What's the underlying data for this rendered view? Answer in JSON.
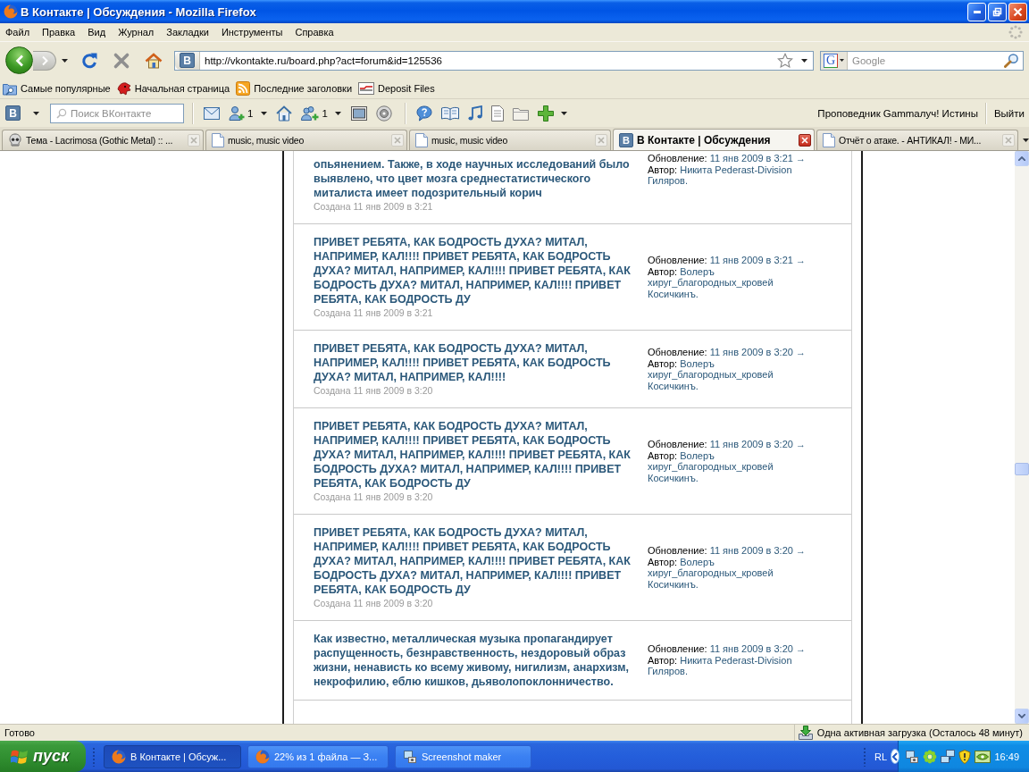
{
  "window": {
    "title": "В Контакте | Обсуждения - Mozilla Firefox"
  },
  "menu": [
    "Файл",
    "Правка",
    "Вид",
    "Журнал",
    "Закладки",
    "Инструменты",
    "Справка"
  ],
  "navigation": {
    "site_icon": "В",
    "url": "http://vkontakte.ru/board.php?act=forum&id=125536",
    "search_engine_icon": "G",
    "search": {
      "placeholder": "Google"
    }
  },
  "bookmarks": [
    {
      "kind": "folder",
      "label": "Самые популярные"
    },
    {
      "kind": "beast",
      "label": "Начальная страница"
    },
    {
      "kind": "feed",
      "label": "Последние заголовки"
    },
    {
      "kind": "card",
      "label": "Deposit Files"
    }
  ],
  "vk_toolbar": {
    "logo": "В",
    "search": {
      "placeholder": "Поиск ВКонтакте"
    },
    "counters": [
      "1",
      "1"
    ],
    "user_link": "Проповедник Gammaлуч! Истины",
    "logout": "Выйти"
  },
  "tabs": [
    {
      "kind": "skull",
      "label": "Тема - Lacrimosa (Gothic Metal) :: ...",
      "selected": false
    },
    {
      "kind": "page",
      "label": "music, music video",
      "selected": false
    },
    {
      "kind": "page",
      "label": "music, music video",
      "selected": false
    },
    {
      "kind": "logo",
      "icon_letter": "В",
      "label": "В Контакте | Обсуждения",
      "selected": true
    },
    {
      "kind": "page",
      "label": "Отчёт о атаке. - АНТИКАЛ! - МИ...",
      "selected": false
    }
  ],
  "topics": [
    {
      "title": "опьянением. Также, в ходе научных исследований было выявлено, что цвет мозга среднестатистического миталиста имеет подозрительный корич",
      "created": "Создана 11 янв 2009 в 3:21",
      "updated_label": "Обновление:",
      "updated": "11 янв 2009 в 3:21 →",
      "author_label": "Автор:",
      "author": "Никита Pederast-Division Гиляров."
    },
    {
      "title": "ПРИВЕТ РЕБЯТА, КАК БОДРОСТЬ ДУХА? МИТАЛ, НАПРИМЕР, КАЛ!!!! ПРИВЕТ РЕБЯТА, КАК БОДРОСТЬ ДУХА? МИТАЛ, НАПРИМЕР, КАЛ!!!! ПРИВЕТ РЕБЯТА, КАК БОДРОСТЬ ДУХА? МИТАЛ, НАПРИМЕР, КАЛ!!!! ПРИВЕТ РЕБЯТА, КАК БОДРОСТЬ ДУ",
      "created": "Создана 11 янв 2009 в 3:21",
      "updated_label": "Обновление:",
      "updated": "11 янв 2009 в 3:21 →",
      "author_label": "Автор:",
      "author": "Волеръ хируг_благородных_кровей Косичкинъ."
    },
    {
      "title": "ПРИВЕТ РЕБЯТА, КАК БОДРОСТЬ ДУХА? МИТАЛ, НАПРИМЕР, КАЛ!!!! ПРИВЕТ РЕБЯТА, КАК БОДРОСТЬ ДУХА? МИТАЛ, НАПРИМЕР, КАЛ!!!!",
      "created": "Создана 11 янв 2009 в 3:20",
      "updated_label": "Обновление:",
      "updated": "11 янв 2009 в 3:20 →",
      "author_label": "Автор:",
      "author": "Волеръ хируг_благородных_кровей Косичкинъ."
    },
    {
      "title": "ПРИВЕТ РЕБЯТА, КАК БОДРОСТЬ ДУХА? МИТАЛ, НАПРИМЕР, КАЛ!!!! ПРИВЕТ РЕБЯТА, КАК БОДРОСТЬ ДУХА? МИТАЛ, НАПРИМЕР, КАЛ!!!! ПРИВЕТ РЕБЯТА, КАК БОДРОСТЬ ДУХА? МИТАЛ, НАПРИМЕР, КАЛ!!!! ПРИВЕТ РЕБЯТА, КАК БОДРОСТЬ ДУ",
      "created": "Создана 11 янв 2009 в 3:20",
      "updated_label": "Обновление:",
      "updated": "11 янв 2009 в 3:20 →",
      "author_label": "Автор:",
      "author": "Волеръ хируг_благородных_кровей Косичкинъ."
    },
    {
      "title": "ПРИВЕТ РЕБЯТА, КАК БОДРОСТЬ ДУХА? МИТАЛ, НАПРИМЕР, КАЛ!!!! ПРИВЕТ РЕБЯТА, КАК БОДРОСТЬ ДУХА? МИТАЛ, НАПРИМЕР, КАЛ!!!! ПРИВЕТ РЕБЯТА, КАК БОДРОСТЬ ДУХА? МИТАЛ, НАПРИМЕР, КАЛ!!!! ПРИВЕТ РЕБЯТА, КАК БОДРОСТЬ ДУ",
      "created": "Создана 11 янв 2009 в 3:20",
      "updated_label": "Обновление:",
      "updated": "11 янв 2009 в 3:20 →",
      "author_label": "Автор:",
      "author": "Волеръ хируг_благородных_кровей Косичкинъ."
    },
    {
      "title": "Как известно, металлическая музыка пропагандирует распущенность, безнравственность, нездоровый образ жизни, ненависть ко всему живому, нигилизм, анархизм, некрофилию, еблю кишков, дьяволопоклонничество.",
      "updated_label": "Обновление:",
      "updated": "11 янв 2009 в 3:20 →",
      "author_label": "Автор:",
      "author": "Никита Pederast-Division Гиляров."
    }
  ],
  "status_bar": {
    "text": "Готово",
    "download": "Одна активная загрузка (Осталось 48 минут)"
  },
  "taskbar": {
    "start": "пуск",
    "tasks": [
      {
        "kind": "browser",
        "label": "В Контакте | Обсуж...",
        "selected": true
      },
      {
        "kind": "browser",
        "label": "22% из 1 файла — З...",
        "selected": false
      },
      {
        "kind": "app",
        "label": "Screenshot maker",
        "selected": false
      }
    ],
    "language": "RL",
    "clock": "16:49"
  }
}
